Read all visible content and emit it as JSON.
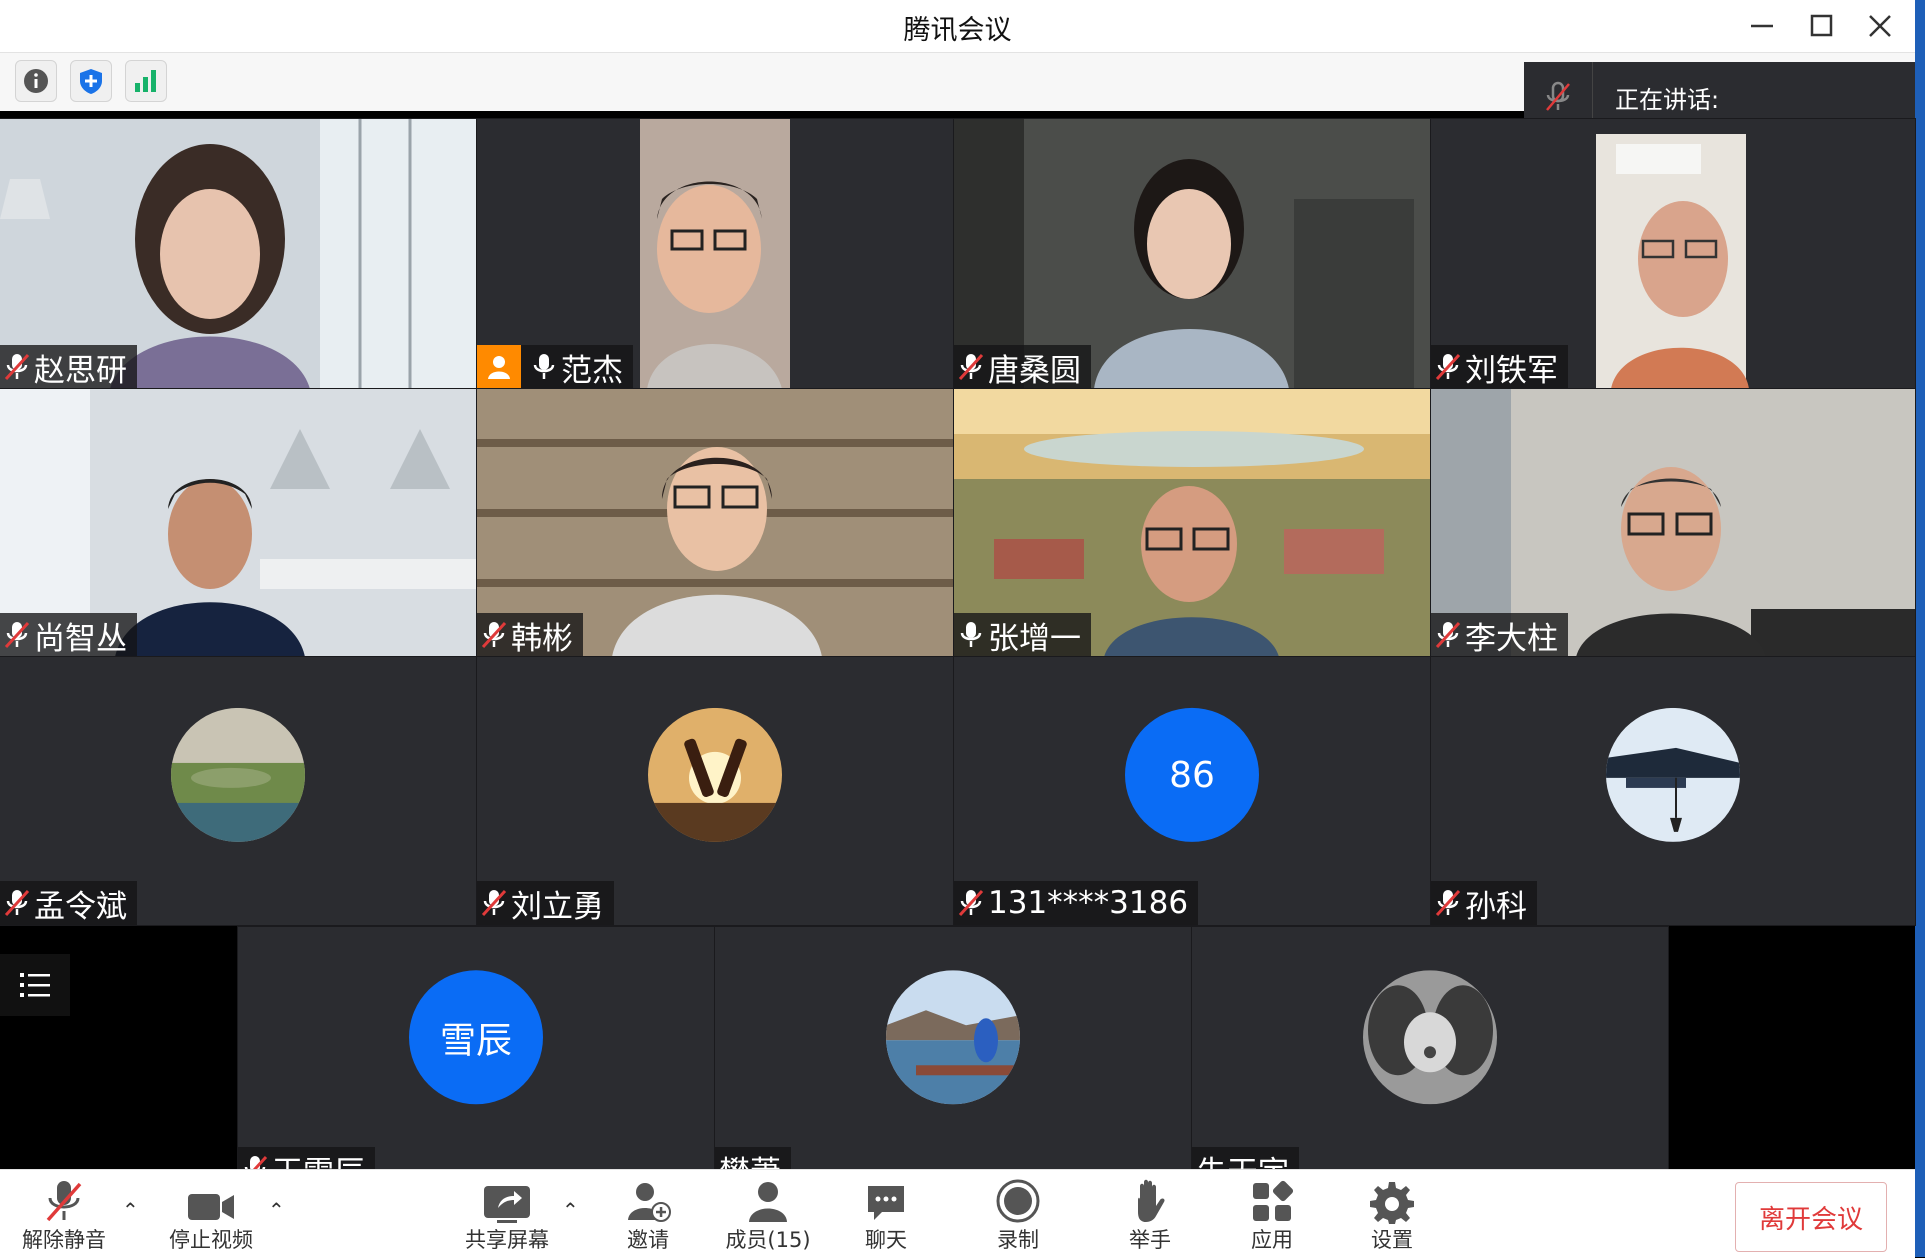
{
  "window": {
    "title": "腾讯会议"
  },
  "speaking": {
    "label": "正在讲话:"
  },
  "participants": {
    "row1": [
      {
        "name": "赵思研",
        "mic": "muted"
      },
      {
        "name": "范杰",
        "mic": "on",
        "host_badge": true
      },
      {
        "name": "唐桑圆",
        "mic": "muted"
      },
      {
        "name": "刘铁军",
        "mic": "muted"
      }
    ],
    "row2": [
      {
        "name": "尚智丛",
        "mic": "muted"
      },
      {
        "name": "韩彬",
        "mic": "muted"
      },
      {
        "name": "张增一",
        "mic": "on"
      },
      {
        "name": "李大柱",
        "mic": "muted"
      }
    ],
    "row3": [
      {
        "name": "孟令斌",
        "mic": "muted",
        "avatar": "landscape"
      },
      {
        "name": "刘立勇",
        "mic": "muted",
        "avatar": "sunset-bottles"
      },
      {
        "name": "131****3186",
        "mic": "muted",
        "avatar_text": "86"
      },
      {
        "name": "孙科",
        "mic": "muted",
        "avatar": "pagoda"
      }
    ],
    "row4": [
      {
        "name": "王雪辰",
        "mic": "muted",
        "avatar_text": "雪辰"
      },
      {
        "name": "樊萧",
        "mic": "none",
        "avatar": "lake"
      },
      {
        "name": "朱天宇",
        "mic": "none",
        "avatar": "baby"
      }
    ]
  },
  "toolbar": {
    "unmute": "解除静音",
    "stop_video": "停止视频",
    "share_screen": "共享屏幕",
    "invite": "邀请",
    "members": "成员(15)",
    "chat": "聊天",
    "record": "录制",
    "raise_hand": "举手",
    "apps": "应用",
    "settings": "设置",
    "leave": "离开会议"
  },
  "colors": {
    "accent": "#0a6cf5",
    "tile_bg": "#2b2c30",
    "leave": "#e03a3a",
    "host_badge": "#ff8a00"
  }
}
